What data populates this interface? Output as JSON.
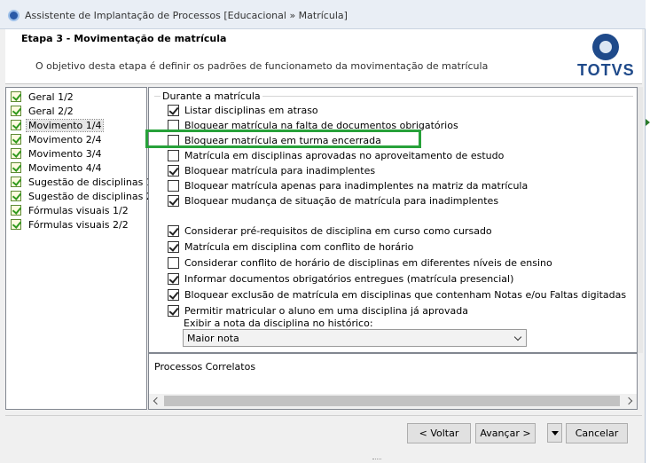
{
  "window": {
    "title": "Assistente de Implantação de Processos [Educacional » Matrícula]"
  },
  "header": {
    "step_title": "Etapa 3 - Movimentação de matrícula",
    "description": "O objetivo desta etapa é definir os padrões de funcionameto da movimentação de matrícula",
    "logo_text": "TOTVS"
  },
  "nav": {
    "items": [
      {
        "label": "Geral 1/2"
      },
      {
        "label": "Geral 2/2"
      },
      {
        "label": "Movimento 1/4"
      },
      {
        "label": "Movimento 2/4"
      },
      {
        "label": "Movimento 3/4"
      },
      {
        "label": "Movimento 4/4"
      },
      {
        "label": "Sugestão de disciplinas 1/2"
      },
      {
        "label": "Sugestão de disciplinas 2/2"
      },
      {
        "label": "Fórmulas visuais 1/2"
      },
      {
        "label": "Fórmulas visuais 2/2"
      }
    ],
    "selected_index": 2
  },
  "group": {
    "label": "Durante a matrícula"
  },
  "options": [
    {
      "label": "Listar disciplinas em atraso",
      "checked": true
    },
    {
      "label": "Bloquear matrícula na falta de documentos obrigatórios",
      "checked": false
    },
    {
      "label": "Bloquear matrícula em turma encerrada",
      "checked": false
    },
    {
      "label": "Matrícula em disciplinas aprovadas no aproveitamento de estudo",
      "checked": false
    },
    {
      "label": "Bloquear matrícula para inadimplentes",
      "checked": true
    },
    {
      "label": "Bloquear matrícula apenas para inadimplentes na matriz da matrícula",
      "checked": false
    },
    {
      "label": "Bloquear mudança de situação de matrícula para inadimplentes",
      "checked": true
    },
    {
      "label": "Considerar pré-requisitos de disciplina em curso como cursado",
      "checked": true
    },
    {
      "label": "Matrícula em disciplina com conflito de horário",
      "checked": true
    },
    {
      "label": "Considerar conflito de horário de disciplinas em diferentes níveis de ensino",
      "checked": false
    },
    {
      "label": "Informar documentos obrigatórios entregues (matrícula presencial)",
      "checked": true
    },
    {
      "label": "Bloquear exclusão de matrícula em disciplinas que contenham Notas e/ou Faltas digitadas",
      "checked": true
    },
    {
      "label": "Permitir matricular o aluno em uma disciplina já aprovada",
      "checked": true
    }
  ],
  "grade_display": {
    "label": "Exibir a nota da disciplina no histórico:",
    "selected": "Maior nota"
  },
  "related": {
    "title": "Processos Correlatos"
  },
  "footer": {
    "back_label": "< Voltar",
    "next_label": "Avançar >",
    "cancel_label": "Cancelar"
  },
  "colors": {
    "highlight": "#27a13a",
    "logo": "#1f4a8a"
  }
}
